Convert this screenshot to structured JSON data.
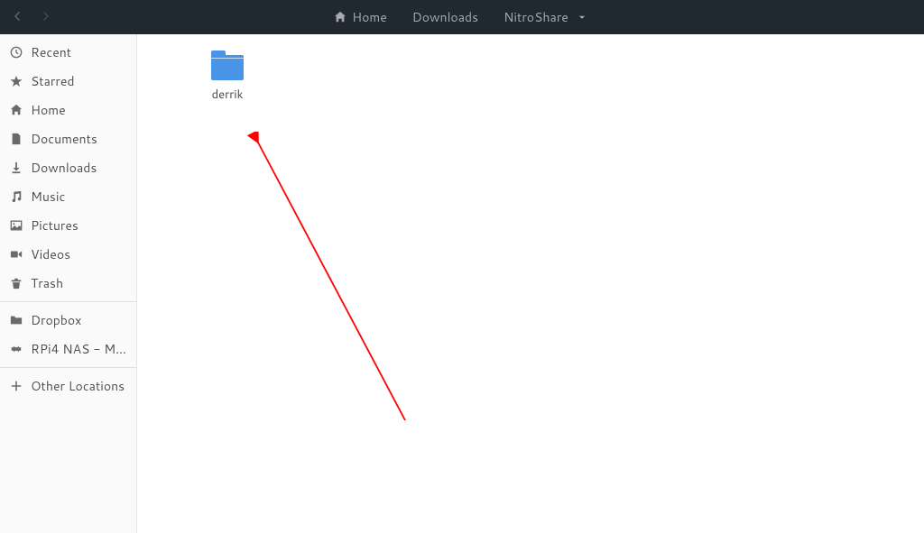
{
  "breadcrumbs": [
    {
      "label": "Home",
      "has_icon": true
    },
    {
      "label": "Downloads"
    },
    {
      "label": "NitroShare",
      "dropdown": true
    }
  ],
  "sidebar": {
    "places": [
      {
        "icon": "recent",
        "label": "Recent"
      },
      {
        "icon": "star",
        "label": "Starred"
      },
      {
        "icon": "home",
        "label": "Home"
      },
      {
        "icon": "document",
        "label": "Documents"
      },
      {
        "icon": "download",
        "label": "Downloads"
      },
      {
        "icon": "music",
        "label": "Music"
      },
      {
        "icon": "picture",
        "label": "Pictures"
      },
      {
        "icon": "video",
        "label": "Videos"
      },
      {
        "icon": "trash",
        "label": "Trash"
      }
    ],
    "mounts": [
      {
        "icon": "dropbox",
        "label": "Dropbox"
      },
      {
        "icon": "network",
        "label": "RPi4 NAS - Me..."
      }
    ],
    "other": [
      {
        "icon": "plus",
        "label": "Other Locations"
      }
    ]
  },
  "content": {
    "items": [
      {
        "type": "folder",
        "name": "derrik"
      }
    ]
  }
}
